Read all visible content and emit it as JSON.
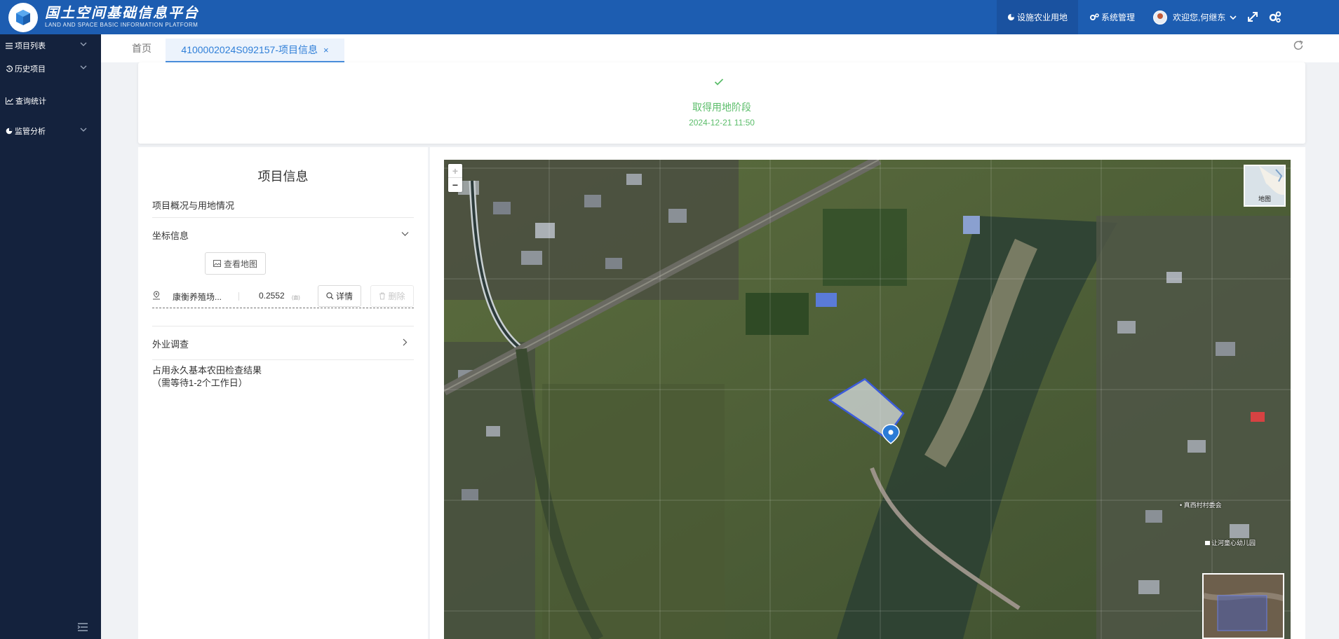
{
  "header": {
    "logo_title": "国土空间基础信息平台",
    "logo_subtitle": "LAND AND SPACE BASIC INFORMATION PLATFORM",
    "nav_active": "设施农业用地",
    "nav_system": "系统管理",
    "user_greeting": "欢迎您,何继东"
  },
  "sidebar": {
    "items": [
      {
        "label": "项目列表",
        "icon": "list-icon",
        "has_chevron": true
      },
      {
        "label": "历史项目",
        "icon": "history-icon",
        "has_chevron": true
      },
      {
        "label": "查询统计",
        "icon": "chart-icon",
        "has_chevron": false
      },
      {
        "label": "监管分析",
        "icon": "pie-icon",
        "has_chevron": true
      }
    ]
  },
  "tabs": {
    "home": "首页",
    "active": "4100002024S092157-项目信息",
    "close": "×"
  },
  "stage": {
    "name": "取得用地阶段",
    "time": "2024-12-21 11:50"
  },
  "project": {
    "title": "项目信息",
    "overview": "项目概况与用地情况",
    "coord_section": "坐标信息",
    "view_map_button": "查看地图",
    "coord_item": {
      "name": "康衡养殖场...",
      "area": "0.2552",
      "unit": "(亩)",
      "detail_button": "详情",
      "delete_button": "删除"
    },
    "field_survey": "外业调查",
    "check_result_line1": "占用永久基本农田检查结果",
    "check_result_line2": "（需等待1-2个工作日）"
  },
  "map": {
    "zoom_in": "+",
    "zoom_out": "−",
    "layer_label": "地图",
    "poi_1": "• 真西村村委会",
    "poi_2": "让河童心幼儿园",
    "colors": {
      "parcel_stroke": "#3b5bdb",
      "marker": "#2b7bd6"
    }
  },
  "colors": {
    "header_bg": "#1d5db1",
    "sidebar_bg": "#14223d",
    "stage_green": "#5bbd6a",
    "tab_active": "#2f7fd8"
  }
}
